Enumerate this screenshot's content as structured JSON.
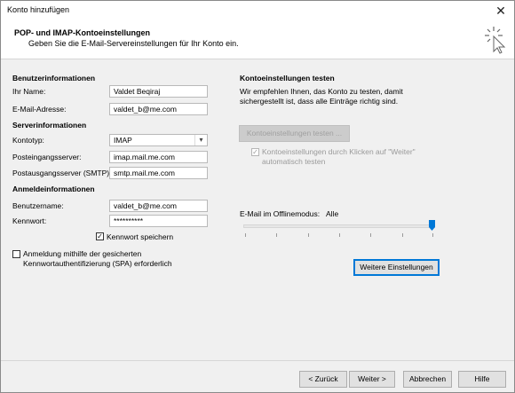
{
  "window": {
    "title": "Konto hinzufügen"
  },
  "header": {
    "title": "POP- und IMAP-Kontoeinstellungen",
    "subtitle": "Geben Sie die E-Mail-Servereinstellungen für Ihr Konto ein."
  },
  "left": {
    "user_section": "Benutzerinformationen",
    "name_label": "Ihr Name:",
    "name_value": "Valdet Beqiraj",
    "email_label": "E-Mail-Adresse:",
    "email_value": "valdet_b@me.com",
    "server_section": "Serverinformationen",
    "account_type_label": "Kontotyp:",
    "account_type_value": "IMAP",
    "incoming_label": "Posteingangsserver:",
    "incoming_value": "imap.mail.me.com",
    "outgoing_label": "Postausgangsserver (SMTP):",
    "outgoing_value": "smtp.mail.me.com",
    "login_section": "Anmeldeinformationen",
    "username_label": "Benutzername:",
    "username_value": "valdet_b@me.com",
    "password_label": "Kennwort:",
    "password_value": "**********",
    "save_password_label": "Kennwort speichern",
    "save_password_checked": true,
    "spa_label_line1": "Anmeldung mithilfe der gesicherten",
    "spa_label_line2": "Kennwortauthentifizierung (SPA) erforderlich",
    "spa_checked": false
  },
  "right": {
    "test_section": "Kontoeinstellungen testen",
    "test_desc_line1": "Wir empfehlen Ihnen, das Konto zu testen, damit",
    "test_desc_line2": "sichergestellt ist, dass alle Einträge richtig sind.",
    "test_button": "Kontoeinstellungen testen ...",
    "auto_test_line1": "Kontoeinstellungen durch Klicken auf \"Weiter\"",
    "auto_test_line2": "automatisch testen",
    "auto_test_checked": true,
    "offline_label": "E-Mail im Offlinemodus:",
    "offline_value": "Alle",
    "offline_slider_fraction": 1.0,
    "more_settings_button": "Weitere Einstellungen"
  },
  "footer": {
    "back_button": "< Zurück",
    "next_button": "Weiter >",
    "cancel_button": "Abbrechen",
    "help_button": "Hilfe"
  },
  "icons": {
    "close": "close-icon",
    "wizard": "sparkle-cursor-icon",
    "dropdown": "chevron-down-icon",
    "check": "checkmark-icon"
  },
  "colors": {
    "accent": "#0078d7",
    "window_bg": "#f0f0f0",
    "header_bg": "#ffffff"
  }
}
